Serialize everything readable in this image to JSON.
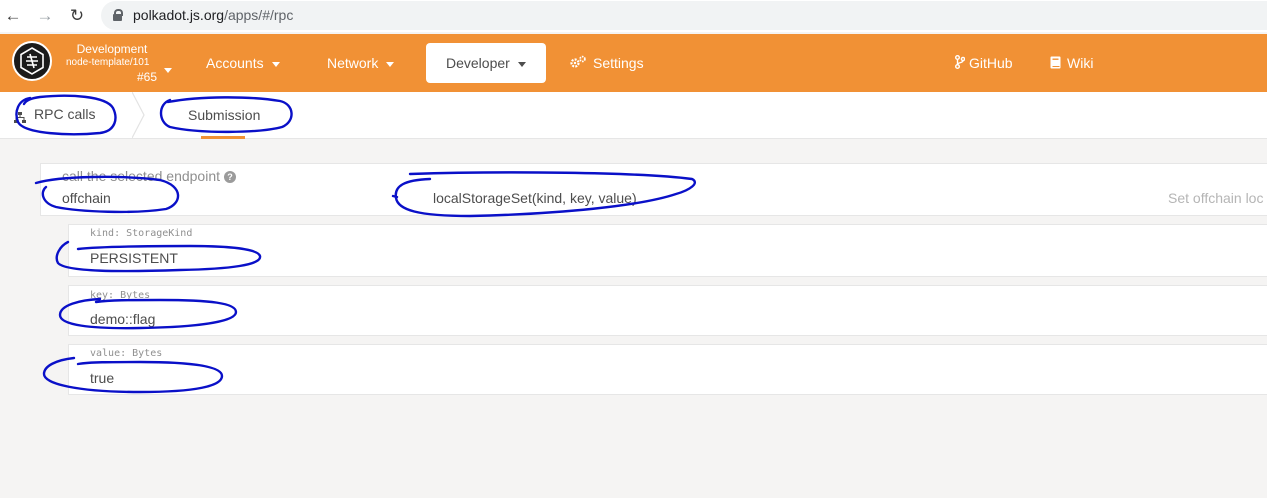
{
  "browser": {
    "url_host": "polkadot.js.org",
    "url_path": "/apps/#/rpc"
  },
  "header": {
    "chain_name": "Development",
    "chain_version": "node-template/101",
    "block_number": "#65",
    "menu": {
      "accounts": "Accounts",
      "network": "Network",
      "developer": "Developer",
      "settings": "Settings",
      "github": "GitHub",
      "wiki": "Wiki"
    }
  },
  "tabs": {
    "root": "RPC calls",
    "active": "Submission"
  },
  "endpoint": {
    "label": "call the selected endpoint",
    "help": "?",
    "section": "offchain",
    "method": "localStorageSet(kind, key, value)",
    "description": "Set offchain loc"
  },
  "params": [
    {
      "label": "kind: StorageKind",
      "value": "PERSISTENT"
    },
    {
      "label": "key: Bytes",
      "value": "demo::flag"
    },
    {
      "label": "value: Bytes",
      "value": "true"
    }
  ],
  "colors": {
    "accent": "#f19135",
    "annotation": "#0a10c8"
  }
}
